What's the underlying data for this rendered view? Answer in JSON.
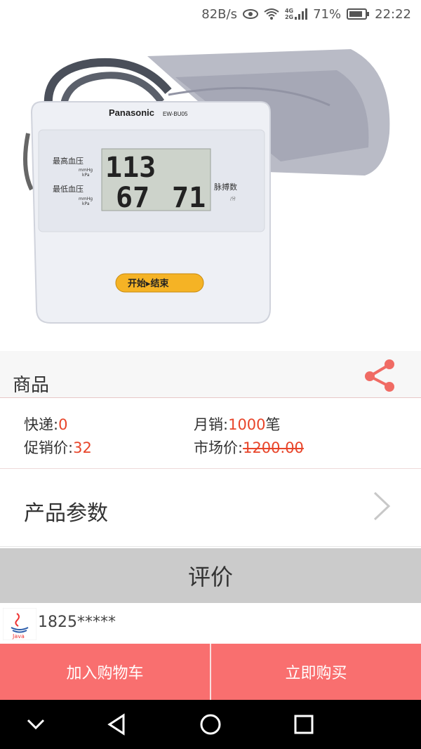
{
  "status_bar": {
    "net_speed": "82B/s",
    "network_type_top": "4G",
    "network_type_bottom": "2G",
    "battery_percent": "71%",
    "time": "22:22"
  },
  "product_image": {
    "brand": "Panasonic",
    "model": "EW-BU05",
    "label_systolic": "最高血压",
    "label_diastolic": "最低血压",
    "unit1": "mmHg",
    "unit2": "kPa",
    "systolic_value": "113",
    "diastolic_value": "67",
    "pulse_value": "71",
    "pulse_label": "脉搏数",
    "pulse_unit": "/分",
    "button_label": "开始▸结束"
  },
  "section": {
    "title": "商品"
  },
  "info": {
    "shipping_label": "快递:",
    "shipping_value": "0",
    "monthly_sales_label": "月销:",
    "monthly_sales_value": "1000",
    "monthly_sales_unit": "笔",
    "promo_label": "促销价:",
    "promo_value": "32",
    "market_label": "市场价:",
    "market_value": "1200.00"
  },
  "params": {
    "label": "产品参数"
  },
  "reviews": {
    "title": "评价",
    "items": [
      {
        "avatar_text": "Java",
        "user": "1825*****"
      }
    ]
  },
  "actions": {
    "add_to_cart": "加入购物车",
    "buy_now": "立即购买"
  },
  "colors": {
    "accent": "#f96f6f",
    "price": "#e8452a",
    "share": "#f06b64"
  }
}
